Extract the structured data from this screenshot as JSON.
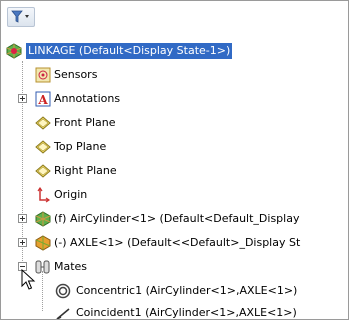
{
  "root": {
    "label": "LINKAGE  (Default<Display State-1>)"
  },
  "items": [
    {
      "label": "Sensors"
    },
    {
      "label": "Annotations"
    },
    {
      "label": "Front Plane"
    },
    {
      "label": "Top Plane"
    },
    {
      "label": "Right Plane"
    },
    {
      "label": "Origin"
    },
    {
      "label": "(f) AirCylinder<1> (Default<Default_Display"
    },
    {
      "label": "(-) AXLE<1> (Default<<Default>_Display St"
    },
    {
      "label": "Mates"
    }
  ],
  "mates": [
    {
      "label": "Concentric1 (AirCylinder<1>,AXLE<1>)"
    },
    {
      "label": "Coincident1 (AirCylinder<1>,AXLE<1>)"
    }
  ],
  "colors": {
    "selection": "#316ac5",
    "plane": "#e8c84a",
    "origin": "#c33"
  }
}
